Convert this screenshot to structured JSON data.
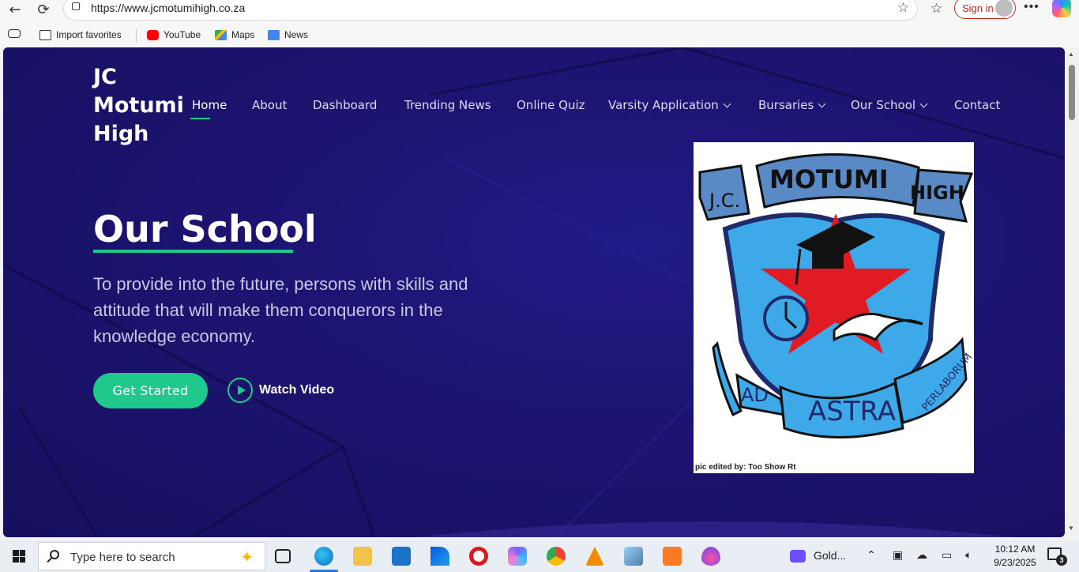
{
  "browser": {
    "url": "https://www.jcmotumihigh.co.za",
    "signin_label": "Sign in",
    "bookmarks": [
      {
        "label": "Import favorites"
      },
      {
        "label": "YouTube"
      },
      {
        "label": "Maps"
      },
      {
        "label": "News"
      }
    ]
  },
  "site": {
    "logo": "JC Motumi High",
    "nav": [
      {
        "label": "Home"
      },
      {
        "label": "About"
      },
      {
        "label": "Dashboard"
      },
      {
        "label": "Trending News"
      },
      {
        "label": "Online Quiz"
      },
      {
        "label": "Varsity Application"
      },
      {
        "label": "Bursaries"
      },
      {
        "label": "Our School"
      },
      {
        "label": "Contact"
      }
    ],
    "hero": {
      "title": "Our School",
      "text": "To provide into the future, persons with skills and attitude that will make them conquerors in the knowledge economy.",
      "cta": "Get Started",
      "watch": "Watch Video"
    },
    "crest": {
      "top_text": "MOTUMI",
      "left_text": "J.C.",
      "right_text": "HIGH",
      "motto_left": "AD",
      "motto_center": "ASTRA",
      "motto_right": "PERLABORUM",
      "credit": "pic edited by: Too Show Rt"
    }
  },
  "taskbar": {
    "search_placeholder": "Type here to search",
    "app_label": "Gold...",
    "time": "10:12 AM",
    "date": "9/23/2025",
    "notifications": "3"
  },
  "colors": {
    "accent": "#1ec98b",
    "background": "#1c1470",
    "signin": "#c42b1c"
  }
}
